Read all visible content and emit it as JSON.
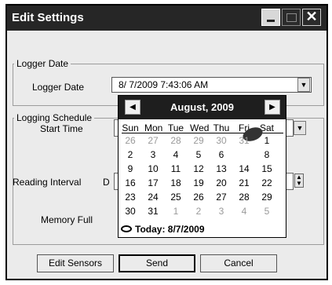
{
  "window": {
    "title": "Edit Settings"
  },
  "logger_date_group": {
    "legend": "Logger Date",
    "label": "Logger Date",
    "value": "8/ 7/2009  7:43:06 AM"
  },
  "schedule_group": {
    "legend": "Logging Schedule",
    "start_label": "Start Time",
    "interval_label": "Reading Interval",
    "interval_prefix": "D",
    "memory_label": "Memory Full"
  },
  "calendar": {
    "month_label": "August, 2009",
    "weekdays": [
      "Sun",
      "Mon",
      "Tue",
      "Wed",
      "Thu",
      "Fri",
      "Sat"
    ],
    "weeks": [
      [
        "26",
        "27",
        "28",
        "29",
        "30",
        "31",
        "1"
      ],
      [
        "2",
        "3",
        "4",
        "5",
        "6",
        "7",
        "8"
      ],
      [
        "9",
        "10",
        "11",
        "12",
        "13",
        "14",
        "15"
      ],
      [
        "16",
        "17",
        "18",
        "19",
        "20",
        "21",
        "22"
      ],
      [
        "23",
        "24",
        "25",
        "26",
        "27",
        "28",
        "29"
      ],
      [
        "30",
        "31",
        "1",
        "2",
        "3",
        "4",
        "5"
      ]
    ],
    "selected_day": "7",
    "today_label": "Today: 8/7/2009"
  },
  "buttons": {
    "edit_sensors": "Edit Sensors",
    "send": "Send",
    "cancel": "Cancel"
  }
}
